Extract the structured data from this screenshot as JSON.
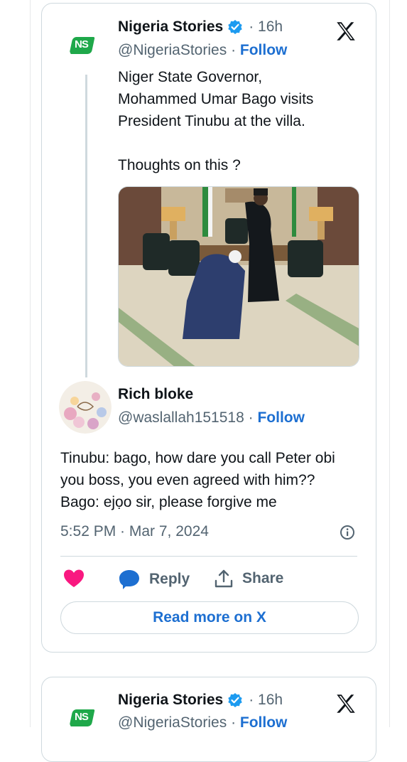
{
  "tweet": {
    "author_name": "Nigeria Stories",
    "handle": "@NigeriaStories",
    "time": "· 16h",
    "separator": "·",
    "follow_label": "Follow",
    "logo_text": "NS",
    "text": "Niger State Governor,\nMohammed Umar Bago visits\nPresident Tinubu at the villa.\n\nThoughts on this ?"
  },
  "reply": {
    "author_name": "Rich bloke",
    "handle": "@waslallah151518",
    "separator": "·",
    "follow_label": "Follow",
    "text": "Tinubu: bago, how dare you call Peter obi\nyou boss, you even agreed with him??\nBago:    ejọo sir, please forgive me",
    "timestamp": "5:52 PM · Mar 7, 2024"
  },
  "actions": {
    "reply_label": "Reply",
    "share_label": "Share",
    "read_more_label": "Read more on X"
  },
  "next_tweet": {
    "author_name": "Nigeria Stories",
    "handle": "@NigeriaStories",
    "time": "· 16h",
    "separator": "·",
    "follow_label": "Follow",
    "logo_text": "NS"
  },
  "colors": {
    "accent": "#1d6fd1",
    "like": "#f91880",
    "brand_green": "#1fa84a",
    "verified": "#1d9bf0"
  }
}
